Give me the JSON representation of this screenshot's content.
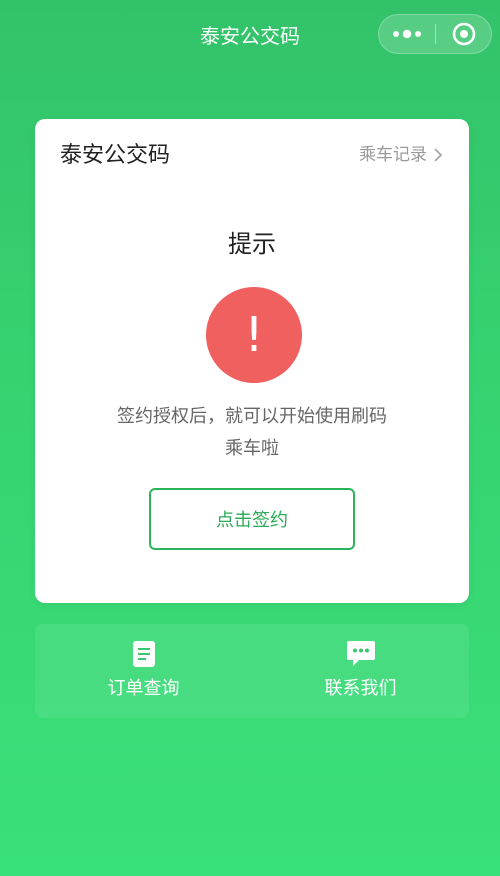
{
  "nav": {
    "title": "泰安公交码"
  },
  "card": {
    "title": "泰安公交码",
    "ride_record_label": "乘车记录",
    "prompt_title": "提示",
    "warning_mark": "!",
    "message_line1": "签约授权后，就可以开始使用刷码",
    "message_line2": "乘车啦",
    "sign_button_label": "点击签约"
  },
  "bottom_menu": {
    "items": [
      {
        "label": "订单查询",
        "icon": "document-icon"
      },
      {
        "label": "联系我们",
        "icon": "chat-bubble-icon"
      }
    ]
  },
  "colors": {
    "background": "#36d06f",
    "warning_red": "#f0605f",
    "primary_green": "#2bb55a"
  }
}
